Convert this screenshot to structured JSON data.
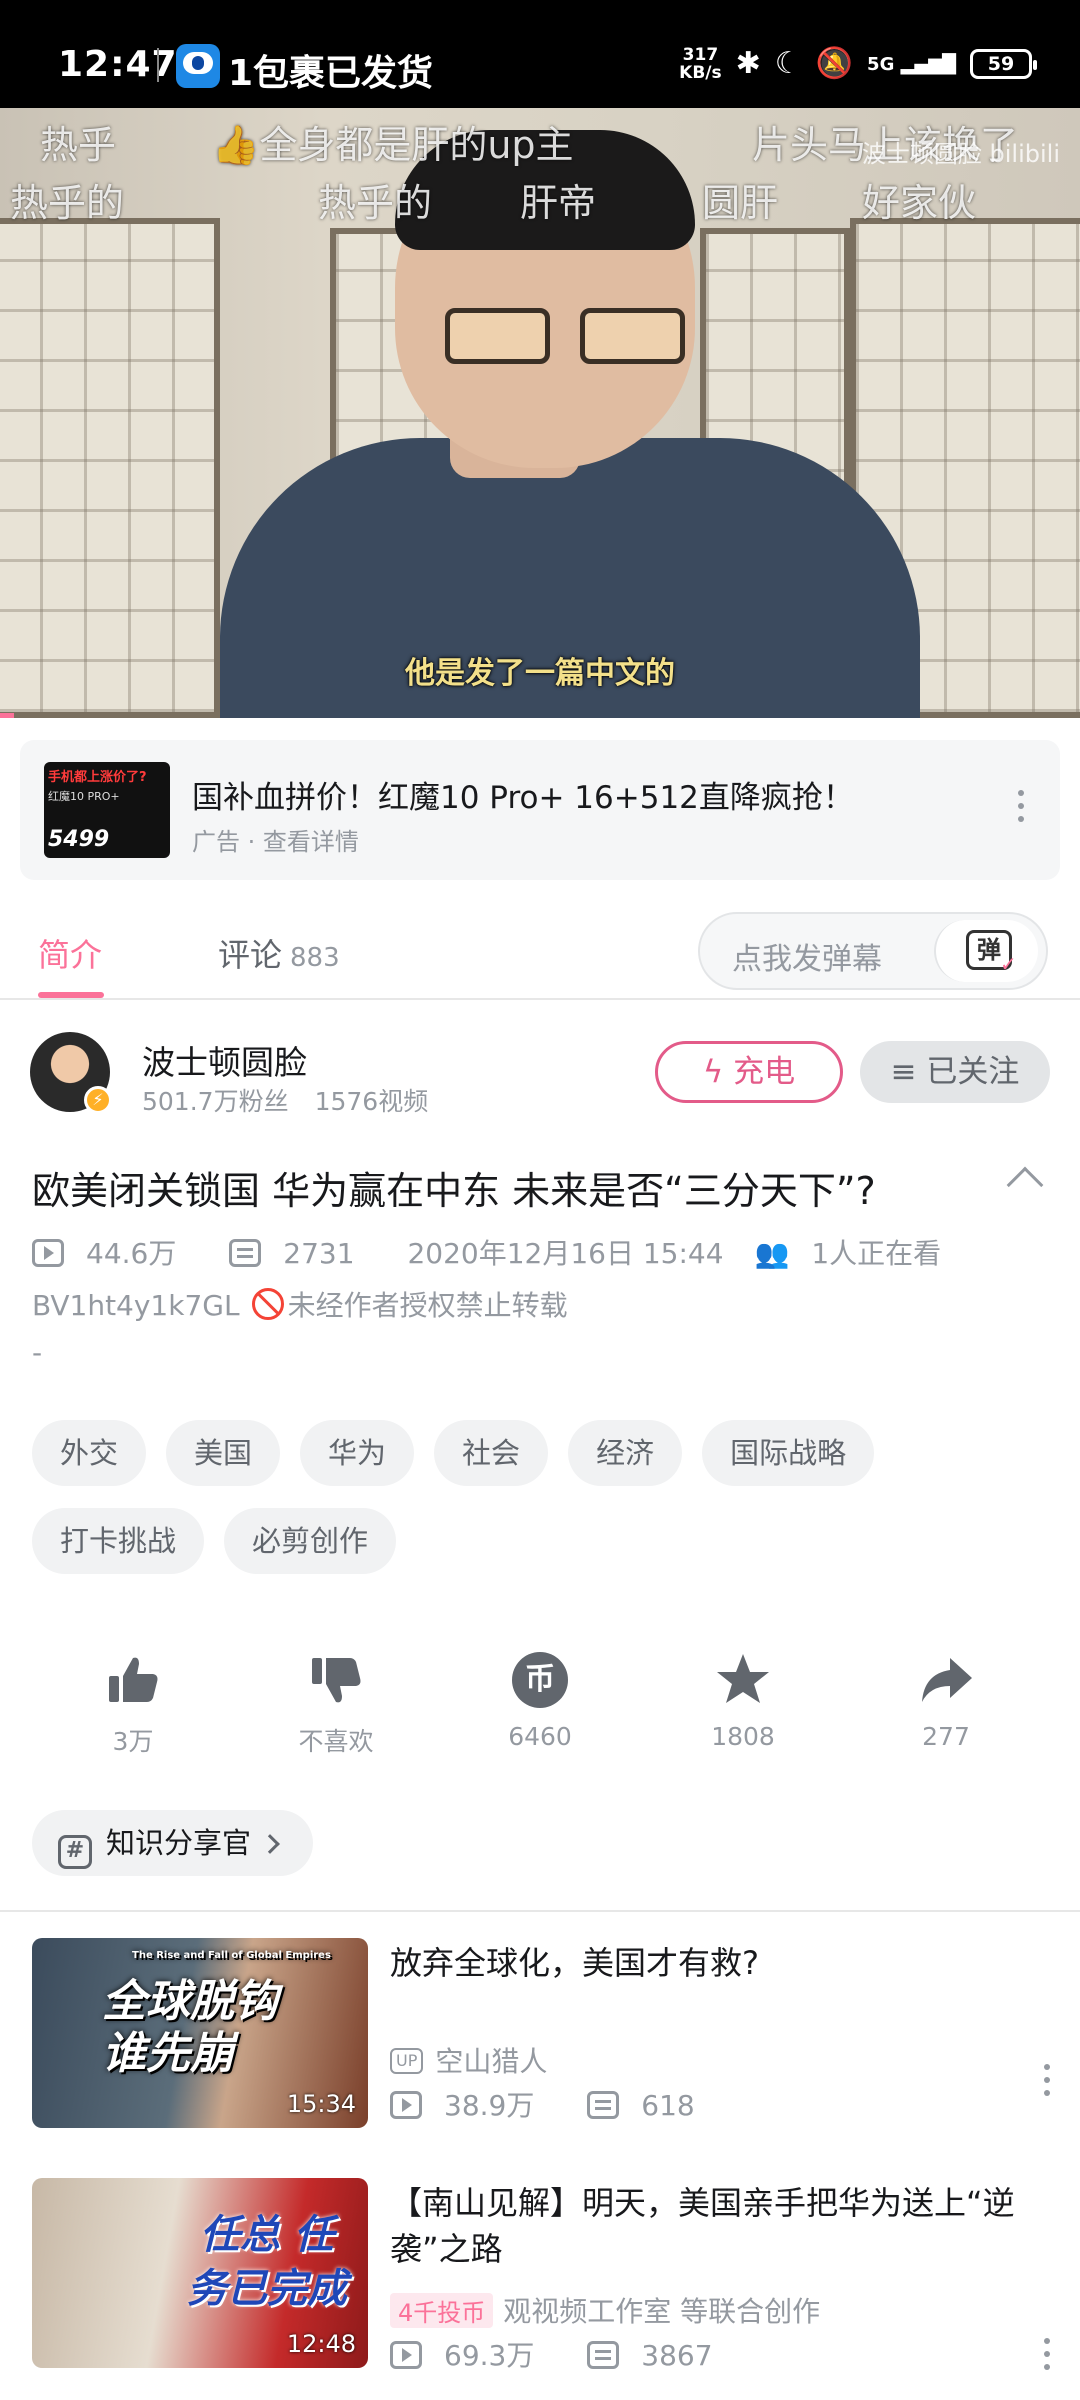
{
  "status_bar": {
    "time": "12:47",
    "notification": "1包裹已发货",
    "net_speed_value": "317",
    "net_speed_unit": "KB/s",
    "signal": "5G",
    "battery": "59"
  },
  "video": {
    "danmaku": [
      "热乎",
      "全身都是肝的up主",
      "片头马上该换了",
      "热乎的",
      "热乎的",
      "肝帝",
      "圆肝",
      "好家伙"
    ],
    "subtitle": "他是发了一篇中文的",
    "watermark": "波士顿圆脸 bilibili",
    "progress": 0.013
  },
  "ad": {
    "thumb_line1": "手机都上涨价了?",
    "thumb_line2": "红魔10 PRO+",
    "thumb_price": "5499",
    "title": "国补血拼价！红魔10 Pro+ 16+512直降疯抢！",
    "subtitle": "广告 · 查看详情"
  },
  "tabs": {
    "intro": "简介",
    "comments": "评论",
    "comment_count": "883",
    "danmu_placeholder": "点我发弹幕",
    "danmu_button": "弹"
  },
  "uploader": {
    "name": "波士顿圆脸",
    "fans": "501.7万粉丝",
    "videos": "1576视频",
    "charge_label": "充电",
    "follow_label": "已关注"
  },
  "video_info": {
    "title": "欧美闭关锁国 华为赢在中东 未来是否“三分天下”?",
    "views": "44.6万",
    "danmaku_count": "2731",
    "date": "2020年12月16日 15:44",
    "watching": "1人正在看",
    "bvid": "BV1ht4y1k7GL",
    "copyright": "未经作者授权禁止转载",
    "desc": "-"
  },
  "tags": [
    "外交",
    "美国",
    "华为",
    "社会",
    "经济",
    "国际战略",
    "打卡挑战",
    "必剪创作"
  ],
  "actions": {
    "like": "3万",
    "dislike": "不喜欢",
    "coin": "6460",
    "favorite": "1808",
    "share": "277"
  },
  "topic": "知识分享官",
  "related": [
    {
      "thumb_text": "全球脱钩 谁先崩",
      "thumb_small": "The Rise and Fall of Global Empires",
      "duration": "15:34",
      "title": "放弃全球化，美国才有救?",
      "author_tag": "UP",
      "author": "空山猎人",
      "views": "38.9万",
      "danmaku": "618"
    },
    {
      "thumb_text": "任总 任务已完成",
      "duration": "12:48",
      "title": "【南山见解】明天，美国亲手把华为送上“逆袭”之路",
      "author_tag": "4千投币",
      "author": "观视频工作室 等联合创作",
      "views": "69.3万",
      "danmaku": "3867"
    }
  ],
  "colors": {
    "accent": "#fb7299",
    "text_primary": "#18191c",
    "text_secondary": "#9499a0"
  }
}
